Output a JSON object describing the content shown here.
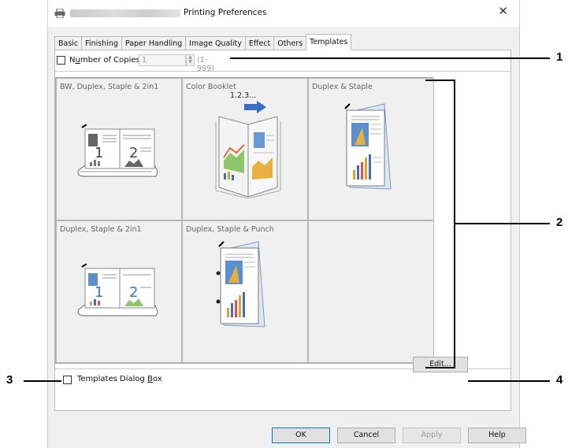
{
  "window": {
    "title": "Printing Preferences",
    "close_symbol": "✕"
  },
  "tabs": [
    "Basic",
    "Finishing",
    "Paper Handling",
    "Image Quality",
    "Effect",
    "Others",
    "Templates"
  ],
  "active_tab": "Templates",
  "copies": {
    "label_pre": "N",
    "label_underlined": "u",
    "label_post": "mber of Copies:",
    "value": "1",
    "range": "(1-999)",
    "checked": false
  },
  "templates": [
    {
      "label": "BW, Duplex, Staple & 2in1",
      "icon": "bw-duplex-2in1-icon"
    },
    {
      "label": "Color Booklet",
      "icon": "color-booklet-icon",
      "sub": "1.2.3..."
    },
    {
      "label": "Duplex & Staple",
      "icon": "duplex-staple-icon"
    },
    {
      "label": "Duplex, Staple & 2in1",
      "icon": "duplex-2in1-icon"
    },
    {
      "label": "Duplex, Staple & Punch",
      "icon": "duplex-punch-icon"
    },
    {
      "label": "",
      "icon": ""
    }
  ],
  "templates_dialog": {
    "label_pre": "Templates Dialog ",
    "label_underlined": "B",
    "label_post": "ox",
    "checked": false
  },
  "buttons": {
    "edit_pre": "Ed",
    "edit_u": "i",
    "edit_post": "t...",
    "ok": "OK",
    "cancel": "Cancel",
    "apply": "Apply",
    "help": "Help"
  },
  "callouts": [
    "1",
    "2",
    "3",
    "4"
  ],
  "colors": {
    "accent": "#0078d7",
    "arrow_blue": "#3b6fc6"
  }
}
